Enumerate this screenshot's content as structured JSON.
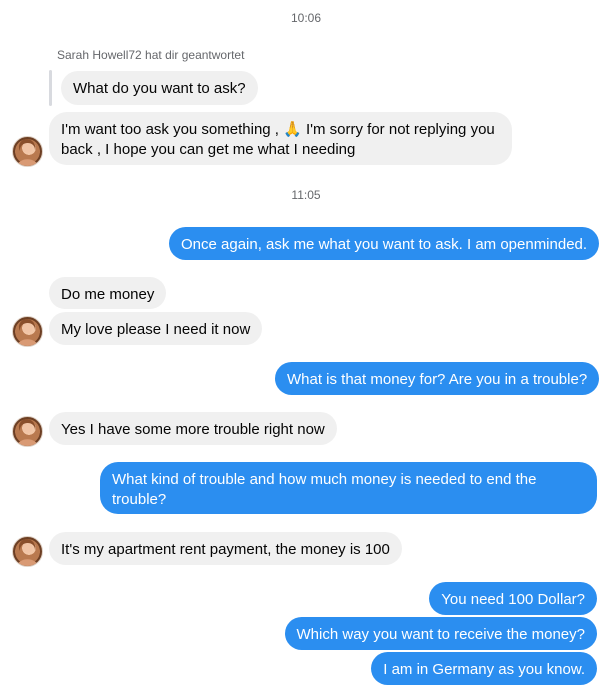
{
  "timestamps": [
    "10:06",
    "11:05"
  ],
  "reply_note": "Sarah Howell72 hat dir geantwortet",
  "messages": [
    {
      "text": "What do you want to ask?"
    },
    {
      "text": "I'm want too ask you something , 🙏 I'm sorry for not replying you back , I hope you can get me what I needing"
    },
    {
      "text": "Once again, ask me what you want to ask. I am openminded."
    },
    {
      "text": "Do me money"
    },
    {
      "text": "My love please I need it now"
    },
    {
      "text": "What is that money for? Are you in a trouble?"
    },
    {
      "text": "Yes I have some more trouble right now"
    },
    {
      "text": "What kind of trouble and how much money is needed to end the trouble?"
    },
    {
      "text": "It's my apartment rent payment, the money is 100"
    },
    {
      "text": "You need 100 Dollar?"
    },
    {
      "text": "Which way you want to receive the money?"
    },
    {
      "text": "I am in Germany as you know."
    }
  ],
  "colors": {
    "outgoing": "#2b8ef0",
    "incoming": "#f0f0f0"
  },
  "icons": {
    "avatar": "contact-avatar"
  }
}
